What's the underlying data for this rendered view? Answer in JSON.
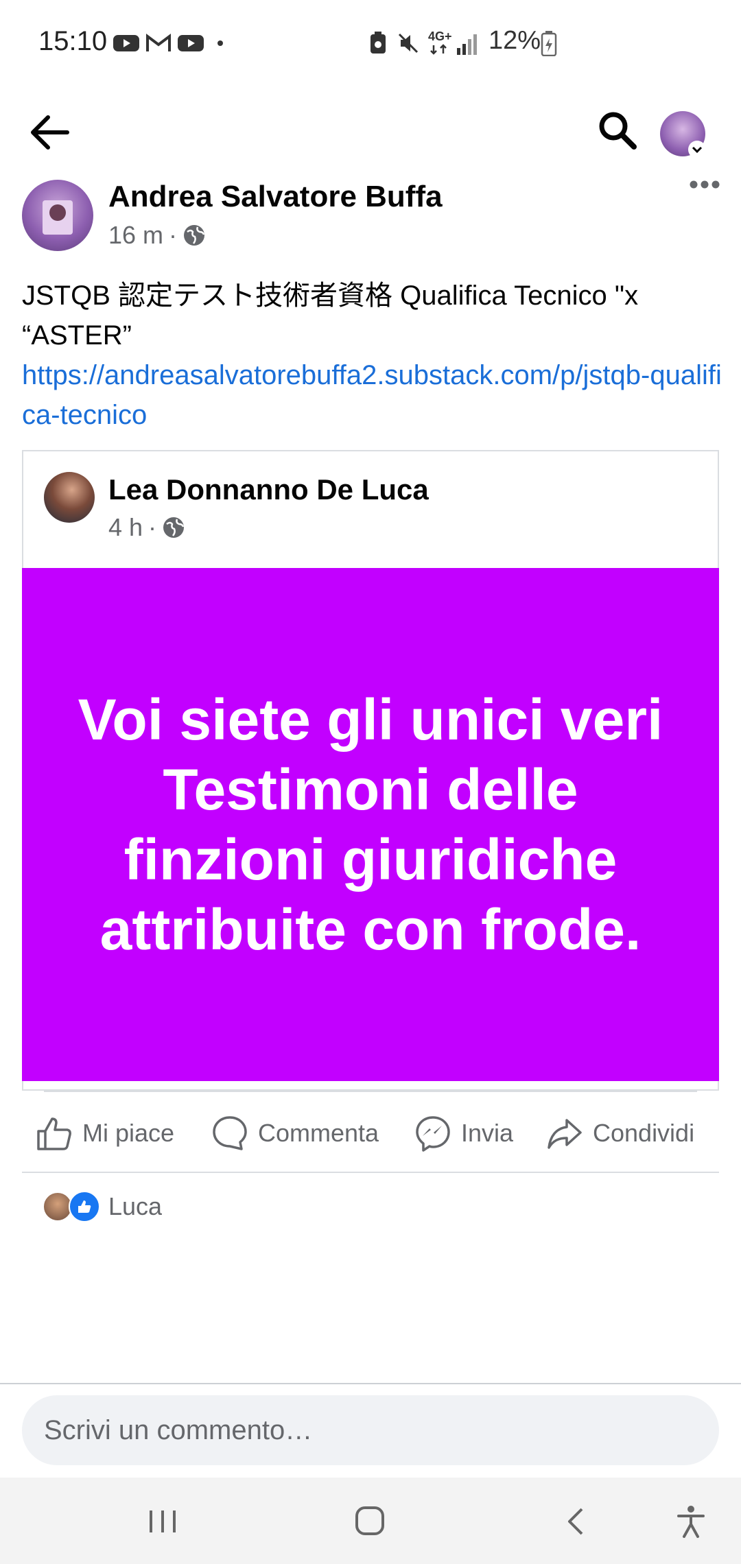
{
  "status_bar": {
    "time": "15:10",
    "battery": "12%",
    "network": "4G+",
    "icons": [
      "youtube-icon",
      "gmail-icon",
      "youtube-icon",
      "dot-icon",
      "recycle-icon",
      "mute-icon",
      "network-icon",
      "signal-icon",
      "battery-icon"
    ]
  },
  "app_bar": {
    "icons": [
      "back-arrow-icon",
      "search-icon",
      "profile-avatar"
    ]
  },
  "post": {
    "author": "Andrea Salvatore Buffa",
    "time": "16 m",
    "dot": "·",
    "privacy_icon": "globe-icon",
    "text": "JSTQB 認定テスト技術者資格 Qualifica Tecnico \"x “ASTER”",
    "link": "https://andreasalvatorebuffa2.substack.com/p/jstqb-qualifica-tecnico"
  },
  "shared": {
    "author": "Lea Donnanno De Luca",
    "time": "4 h",
    "dot": "·",
    "privacy_icon": "globe-icon",
    "text": "Voi siete gli unici veri Testimoni delle finzioni giuridiche attribuite con frode.",
    "background": "#c200ff"
  },
  "actions": {
    "like": "Mi piace",
    "comment": "Commenta",
    "send": "Invia",
    "share": "Condividi"
  },
  "reactions": {
    "reactor": "Luca",
    "icon": "like-icon"
  },
  "comment": {
    "placeholder": "Scrivi un commento…"
  },
  "colors": {
    "accent": "#1877f2",
    "link": "#1a6ed8",
    "secondary_text": "#65676b"
  }
}
